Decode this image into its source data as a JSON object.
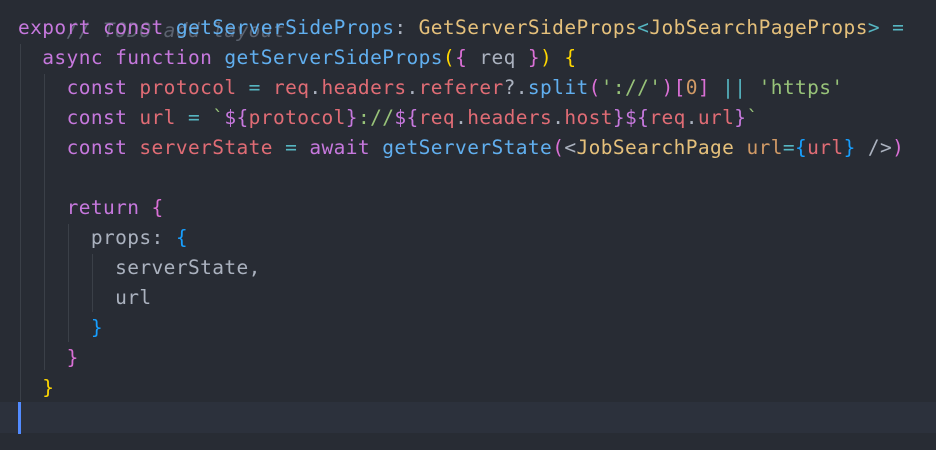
{
  "editor": {
    "comment_line": "// TODO add layout",
    "line1": {
      "export": "export",
      "const": "const",
      "name": "getServerSideProps",
      "colon": ":",
      "type": "GetServerSideProps",
      "lt": "<",
      "generic": "JobSearchPageProps",
      "gt": ">",
      "eq": "="
    },
    "line2": {
      "async": "async",
      "function": "function",
      "name": "getServerSideProps",
      "open_paren": "(",
      "open_brace": "{",
      "param": "req",
      "close_brace": "}",
      "close_paren": ")",
      "body_brace": "{"
    },
    "line3": {
      "const": "const",
      "var": "protocol",
      "eq": "=",
      "obj": "req",
      "dot1": ".",
      "prop1": "headers",
      "dot2": ".",
      "prop2": "referer",
      "opt": "?.",
      "method": "split",
      "open_paren": "(",
      "arg": "'://'",
      "close_paren": ")",
      "open_bracket": "[",
      "index": "0",
      "close_bracket": "]",
      "or": "||",
      "fallback": "'https'"
    },
    "line4": {
      "const": "const",
      "var": "url",
      "eq": "=",
      "tick_open": "`",
      "interp1_open": "${",
      "interp1_var": "protocol",
      "interp1_close": "}",
      "literal": "://",
      "interp2_open": "${",
      "interp2_obj": "req",
      "interp2_dot1": ".",
      "interp2_prop1": "headers",
      "interp2_dot2": ".",
      "interp2_prop2": "host",
      "interp2_close": "}",
      "interp3_open": "${",
      "interp3_obj": "req",
      "interp3_dot": ".",
      "interp3_prop": "url",
      "interp3_close": "}",
      "tick_close": "`"
    },
    "line5": {
      "const": "const",
      "var": "serverState",
      "eq": "=",
      "await": "await",
      "method": "getServerState",
      "open_paren": "(",
      "tag_open": "<",
      "component": "JobSearchPage",
      "attr": "url",
      "attr_eq": "=",
      "attr_open": "{",
      "attr_val": "url",
      "attr_close": "}",
      "self_close": "/>",
      "close_paren": ")"
    },
    "line7": {
      "return": "return",
      "open_brace": "{"
    },
    "line8": {
      "key": "props",
      "colon": ":",
      "open_brace": "{"
    },
    "line9": {
      "item": "serverState,",
      "name_part": "serverState",
      "comma": ","
    },
    "line10": {
      "item": "url"
    },
    "line11": {
      "close_brace": "}"
    },
    "line12": {
      "close_brace": "}"
    },
    "line13": {
      "close_brace": "}"
    }
  }
}
